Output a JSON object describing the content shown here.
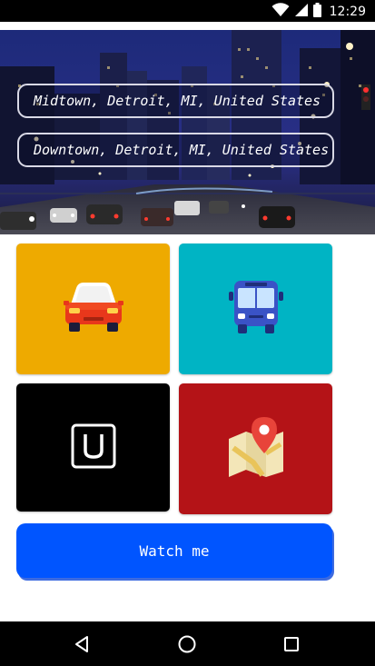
{
  "status_bar": {
    "time": "12:29",
    "icons": [
      "wifi-icon",
      "signal-icon",
      "battery-icon"
    ]
  },
  "route": {
    "origin": "Midtown, Detroit, MI, United States",
    "destination": "Downtown, Detroit, MI, United States"
  },
  "transport_options": [
    {
      "name": "car",
      "icon": "car-icon",
      "color": "#EEAA00"
    },
    {
      "name": "bus",
      "icon": "bus-icon",
      "color": "#00B4C4"
    },
    {
      "name": "uber",
      "icon": "uber-icon",
      "color": "#000000"
    },
    {
      "name": "map",
      "icon": "map-icon",
      "color": "#B41317"
    }
  ],
  "action": {
    "label": "Watch me",
    "color": "#0055FF"
  },
  "nav_bar": {
    "buttons": [
      "back-icon",
      "home-icon",
      "recents-icon"
    ]
  }
}
